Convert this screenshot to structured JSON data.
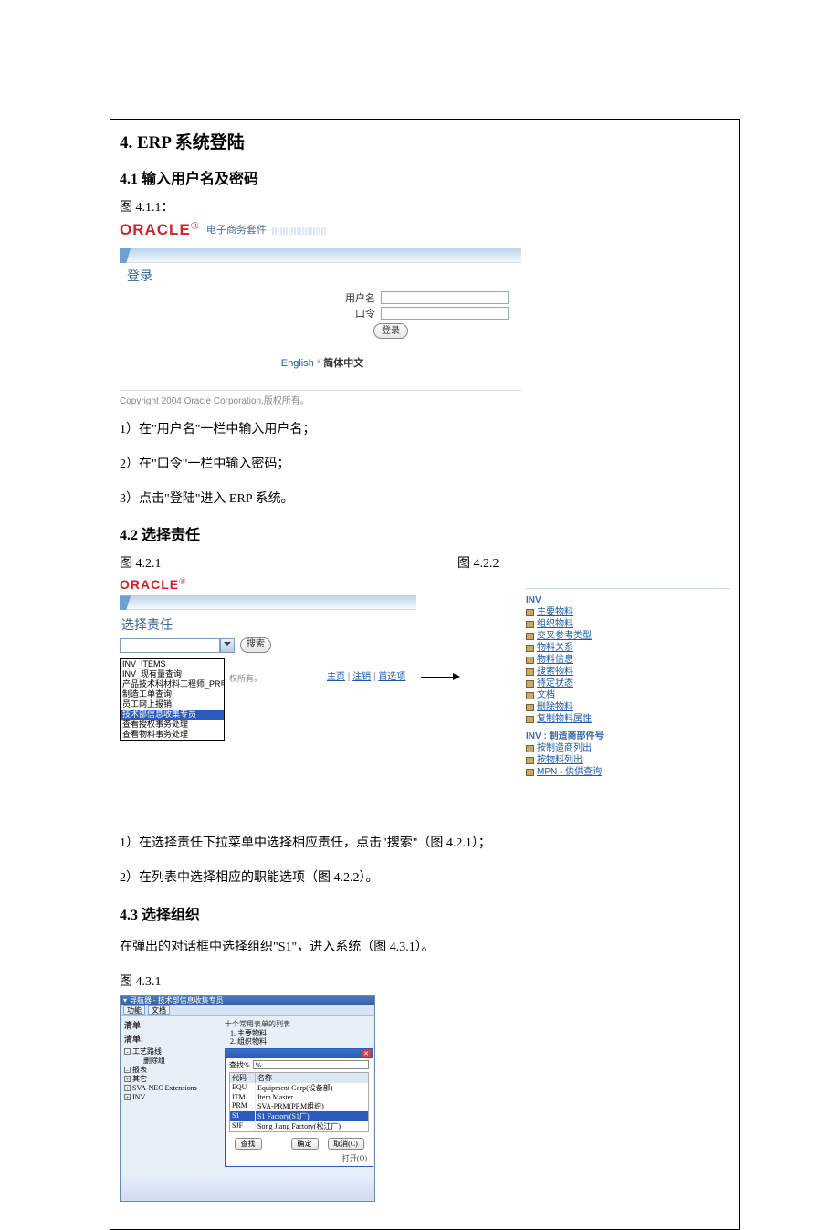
{
  "section4": {
    "title": "4. ERP 系统登陆",
    "s41": {
      "title": "4.1  输入用户名及密码",
      "fig_label": "图 4.1.1：",
      "oracle": "ORACLE",
      "suite_label": "电子商务套件",
      "login_heading": "登录",
      "username_label": "用户名",
      "password_label": "口令",
      "login_btn": "登录",
      "lang_en": "English",
      "lang_zh": "简体中文",
      "copyright": "Copyright 2004 Oracle Corporation.版权所有。",
      "step1": "1）在\"用户名\"一栏中输入用户名；",
      "step2": "2）在\"口令\"一栏中输入密码；",
      "step3": "3）点击\"登陆\"进入 ERP 系统。"
    },
    "s42": {
      "title": "4.2  选择责任",
      "fig1_label": "图 4.2.1",
      "fig2_label": "图 4.2.2",
      "select_resp": "选择责任",
      "search_btn": "搜索",
      "owner_text": "权所有。",
      "options": [
        {
          "text": "INV_ITEMS",
          "selected": false
        },
        {
          "text": "INV_现有量查询",
          "selected": false
        },
        {
          "text": "产品技术科材料工程师_PR申请",
          "selected": false
        },
        {
          "text": "制造工单查询",
          "selected": false
        },
        {
          "text": "员工网上报销",
          "selected": false
        },
        {
          "text": "技术部信息收集专员",
          "selected": true
        },
        {
          "text": "查看授权事务处理",
          "selected": false
        },
        {
          "text": "查看物料事务处理",
          "selected": false
        }
      ],
      "nav_home": "主页",
      "nav_logout": "注销",
      "nav_prefs": "首选项",
      "tree_hdr1": "INV",
      "tree_items1": [
        "主要物料",
        "组织物料",
        "交叉参考类型",
        "物料关系",
        "物料信息",
        "搜索物料",
        "待定状态",
        "文档",
        "删除物料",
        "复制物料属性"
      ],
      "tree_hdr2": "INV : 制造商部件号",
      "tree_items2": [
        "按制造商列出",
        "按物料列出",
        "MPN - 供供查询"
      ],
      "step1": "1）在选择责任下拉菜单中选择相应责任，点击\"搜索\"（图 4.2.1）；",
      "step2": "2）在列表中选择相应的职能选项（图 4.2.2）。"
    },
    "s43": {
      "title": "4.3 选择组织",
      "intro": "在弹出的对话框中选择组织\"S1\"，进入系统（图 4.3.1）。",
      "fig_label": "图 4.3.1",
      "win_title": "导航器 - 技术部信息收集专员",
      "tab_func": "功能",
      "tab_doc": "文档",
      "menu_label": "清单",
      "sub_label": "清单:",
      "right_hdr": "十个常用表单的列表",
      "right_items": [
        "1. 主要物料",
        "2. 组织物料"
      ],
      "left_tree": [
        "- 工艺路线",
        "删除组",
        "- 报表",
        "+ 其它",
        "+ SVA-NEC Extensions",
        "+ INV"
      ],
      "find_label": "查找%",
      "find_value": "%",
      "col_code": "代码",
      "col_name": "名称",
      "rows": [
        {
          "code": "EQU",
          "name": "Equipment Corp(设备部)",
          "selected": false
        },
        {
          "code": "ITM",
          "name": "Item Master",
          "selected": false
        },
        {
          "code": "PRM",
          "name": "SVA-PRM(PRM组织)",
          "selected": false
        },
        {
          "code": "S1",
          "name": "S1 Factory(S1厂)",
          "selected": true
        },
        {
          "code": "SJF",
          "name": "Song Jiang Factory(松江厂)",
          "selected": false
        }
      ],
      "btn_find": "查找",
      "btn_ok": "确定",
      "btn_cancel": "取消(C)",
      "open_label": "打开(O)"
    }
  }
}
